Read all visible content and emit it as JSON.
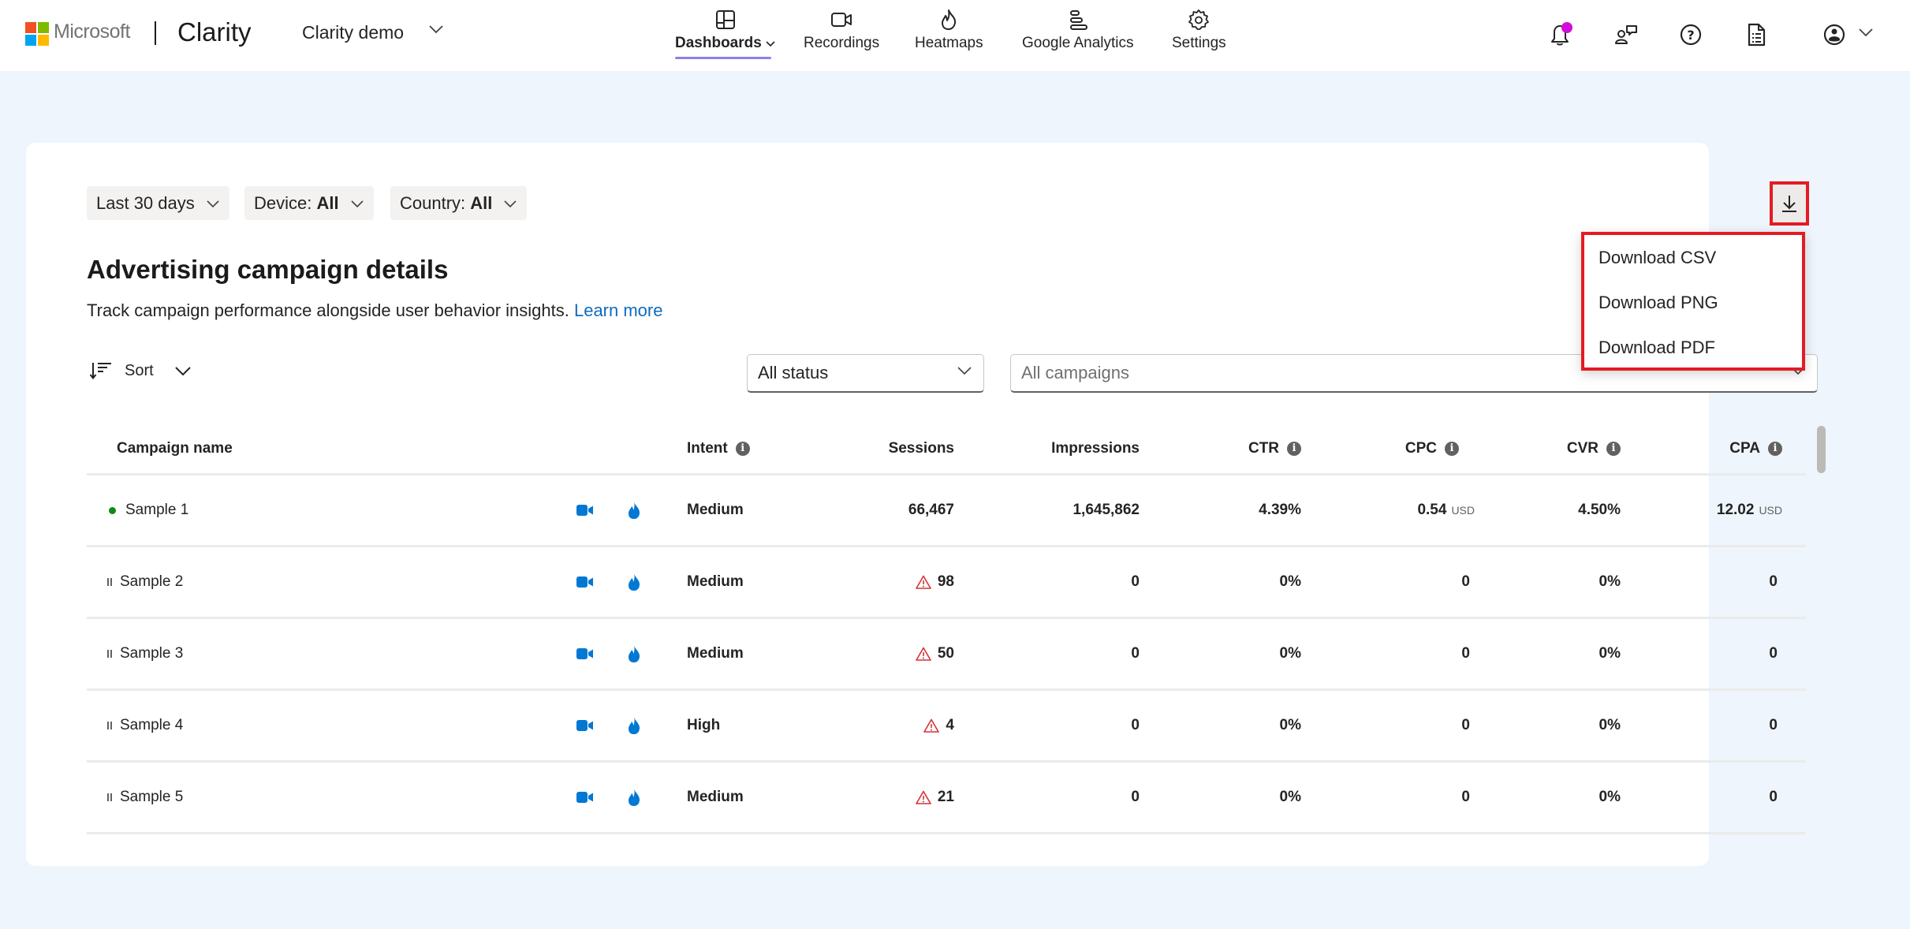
{
  "header": {
    "ms_text": "Microsoft",
    "product": "Clarity",
    "project": "Clarity demo",
    "nav": [
      {
        "label": "Dashboards",
        "icon": "dashboard-icon",
        "active": true
      },
      {
        "label": "Recordings",
        "icon": "video-icon"
      },
      {
        "label": "Heatmaps",
        "icon": "flame-icon"
      },
      {
        "label": "Google Analytics",
        "icon": "analytics-icon"
      },
      {
        "label": "Settings",
        "icon": "gear-icon"
      }
    ],
    "right_icons": [
      "bell-icon",
      "feedback-icon",
      "help-icon",
      "document-icon",
      "account-icon"
    ]
  },
  "filters": {
    "date": "Last 30 days",
    "device_label": "Device:",
    "device_value": "All",
    "country_label": "Country:",
    "country_value": "All"
  },
  "download_menu": {
    "items": [
      "Download CSV",
      "Download PNG",
      "Download PDF"
    ]
  },
  "section": {
    "title": "Advertising campaign details",
    "subtitle": "Track campaign performance alongside user behavior insights.",
    "learn_more": "Learn more"
  },
  "toolbar": {
    "sort_label": "Sort",
    "status_select": "All status",
    "campaign_select_placeholder": "All campaigns"
  },
  "table": {
    "columns": {
      "name": "Campaign name",
      "intent": "Intent",
      "sessions": "Sessions",
      "impressions": "Impressions",
      "ctr": "CTR",
      "cpc": "CPC",
      "cvr": "CVR",
      "cpa": "CPA"
    },
    "currency": "USD",
    "rows": [
      {
        "status": "active",
        "name": "Sample 1",
        "intent": "Medium",
        "sessions": "66,467",
        "sessions_warning": false,
        "impressions": "1,645,862",
        "ctr": "4.39%",
        "cpc": "0.54",
        "cpc_currency": "USD",
        "cvr": "4.50%",
        "cpa": "12.02",
        "cpa_currency": "USD"
      },
      {
        "status": "paused",
        "name": "Sample 2",
        "intent": "Medium",
        "sessions": "98",
        "sessions_warning": true,
        "impressions": "0",
        "ctr": "0%",
        "cpc": "0",
        "cpc_currency": "",
        "cvr": "0%",
        "cpa": "0",
        "cpa_currency": ""
      },
      {
        "status": "paused",
        "name": "Sample 3",
        "intent": "Medium",
        "sessions": "50",
        "sessions_warning": true,
        "impressions": "0",
        "ctr": "0%",
        "cpc": "0",
        "cpc_currency": "",
        "cvr": "0%",
        "cpa": "0",
        "cpa_currency": ""
      },
      {
        "status": "paused",
        "name": "Sample 4",
        "intent": "High",
        "sessions": "4",
        "sessions_warning": true,
        "impressions": "0",
        "ctr": "0%",
        "cpc": "0",
        "cpc_currency": "",
        "cvr": "0%",
        "cpa": "0",
        "cpa_currency": ""
      },
      {
        "status": "paused",
        "name": "Sample 5",
        "intent": "Medium",
        "sessions": "21",
        "sessions_warning": true,
        "impressions": "0",
        "ctr": "0%",
        "cpc": "0",
        "cpc_currency": "",
        "cvr": "0%",
        "cpa": "0",
        "cpa_currency": ""
      }
    ]
  },
  "colors": {
    "accent": "#0f6cbd",
    "icon_blue": "#0078d4",
    "highlight_red": "#e41b23",
    "active_green": "#0e8a16",
    "warning_red": "#d13438",
    "notification": "#d10ed8",
    "nav_underline": "#8b80f0"
  }
}
